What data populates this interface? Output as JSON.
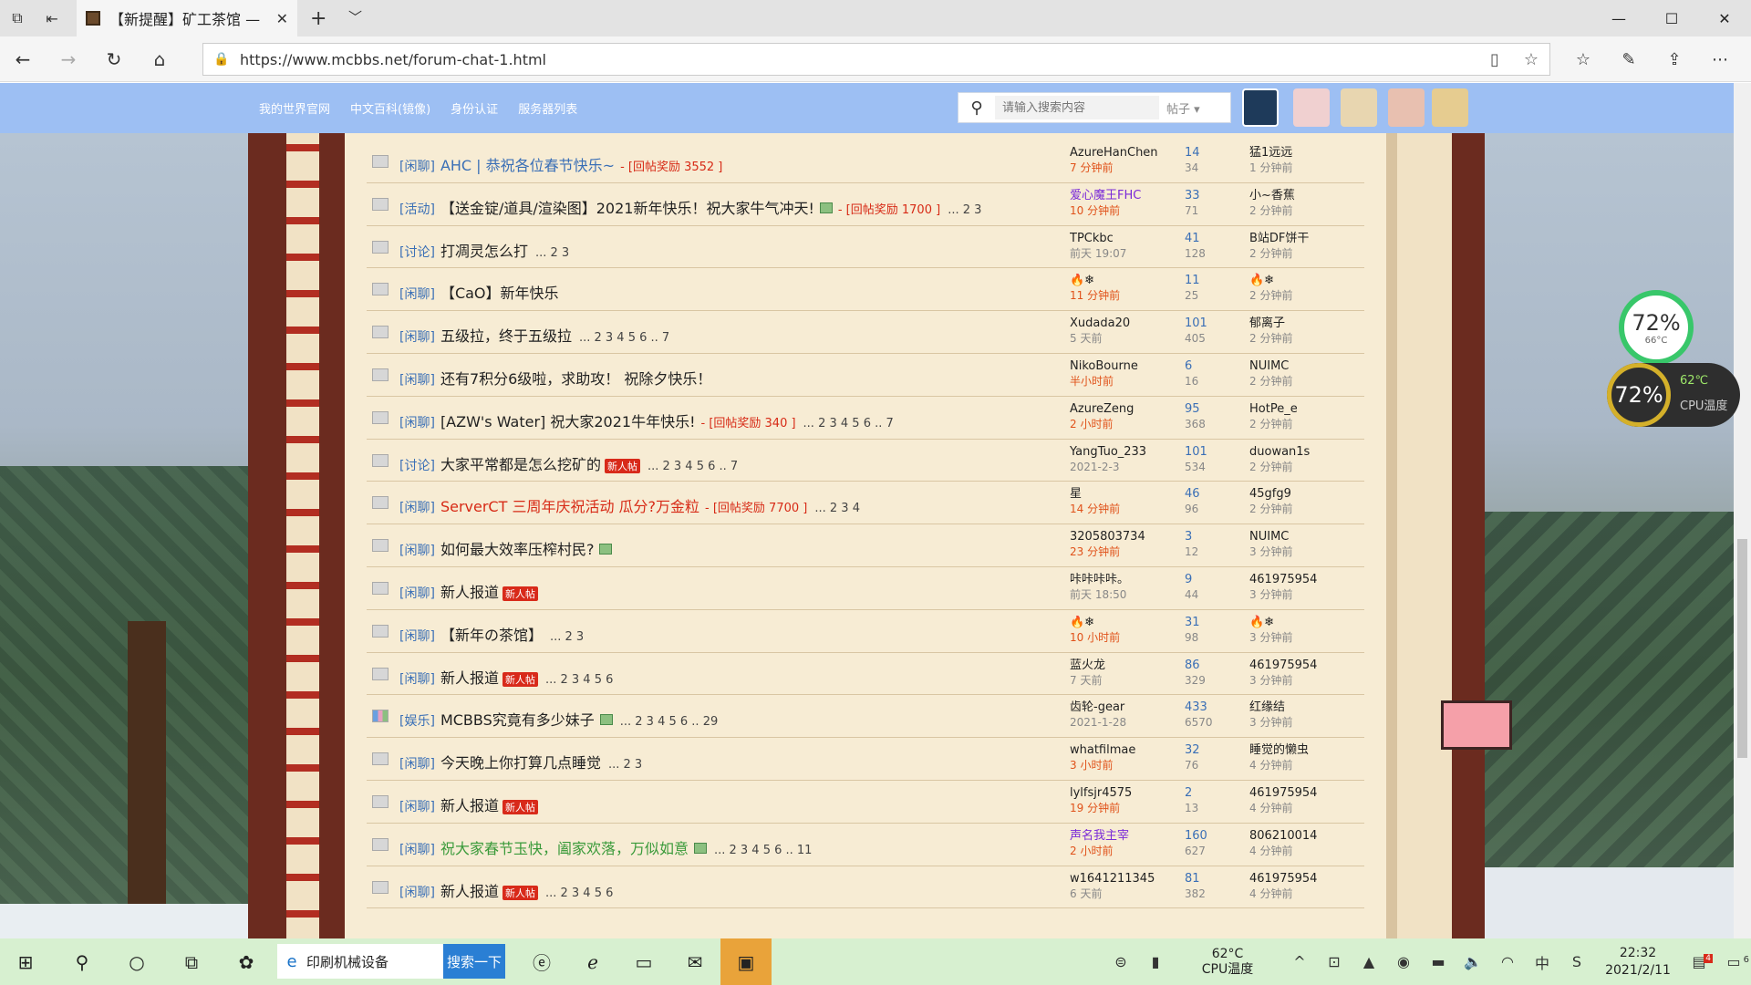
{
  "browser": {
    "tab_title": "【新提醒】矿工茶馆 —",
    "tab_close": "✕",
    "url": "https://www.mcbbs.net/forum-chat-1.html",
    "window_controls": [
      "—",
      "☐",
      "✕"
    ]
  },
  "site": {
    "nav": [
      "我的世界官网",
      "中文百科(镜像)",
      "身份认证",
      "服务器列表"
    ],
    "search_placeholder": "请输入搜索内容",
    "search_scope": "帖子"
  },
  "threads": [
    {
      "cat": "[闲聊]",
      "title": "AHC | 恭祝各位春节快乐~",
      "style": "blue",
      "bonus": "- [回帖奖励 3552 ]",
      "pages": "",
      "badge": "",
      "img": false,
      "author": "AzureHanChen",
      "author_style": "",
      "time": "7 分钟前",
      "time_style": "red",
      "replies": "14",
      "views": "34",
      "last_user": "猛1远远",
      "last_time": "1 分钟前"
    },
    {
      "cat": "[活动]",
      "title": "【送金锭/道具/渲染图】2021新年快乐！祝大家牛气冲天!",
      "style": "",
      "bonus": "- [回帖奖励 1700 ]",
      "pages": "... 2 3",
      "badge": "",
      "img": true,
      "author": "爱心魔王FHC",
      "author_style": "purple",
      "time": "10 分钟前",
      "time_style": "red",
      "replies": "33",
      "views": "71",
      "last_user": "小~香蕉",
      "last_time": "2 分钟前"
    },
    {
      "cat": "[讨论]",
      "title": "打凋灵怎么打",
      "style": "",
      "bonus": "",
      "pages": "... 2 3",
      "badge": "",
      "img": false,
      "author": "TPCkbc",
      "author_style": "",
      "time": "前天 19:07",
      "time_style": "",
      "replies": "41",
      "views": "128",
      "last_user": "B站DF饼干",
      "last_time": "2 分钟前"
    },
    {
      "cat": "[闲聊]",
      "title": "【CaO】新年快乐",
      "style": "",
      "bonus": "",
      "pages": "",
      "badge": "",
      "img": false,
      "author": "🔥❄",
      "author_style": "",
      "time": "11 分钟前",
      "time_style": "red",
      "replies": "11",
      "views": "25",
      "last_user": "🔥❄",
      "last_time": "2 分钟前"
    },
    {
      "cat": "[闲聊]",
      "title": "五级拉，终于五级拉",
      "style": "",
      "bonus": "",
      "pages": "... 2 3 4 5 6 .. 7",
      "badge": "",
      "img": false,
      "author": "Xudada20",
      "author_style": "",
      "time": "5 天前",
      "time_style": "",
      "replies": "101",
      "views": "405",
      "last_user": "郁离子",
      "last_time": "2 分钟前"
    },
    {
      "cat": "[闲聊]",
      "title": "还有7积分6级啦，求助攻！ 祝除夕快乐！",
      "style": "",
      "bonus": "",
      "pages": "",
      "badge": "",
      "img": false,
      "author": "NikoBourne",
      "author_style": "",
      "time": "半小时前",
      "time_style": "red",
      "replies": "6",
      "views": "16",
      "last_user": "NUIMC",
      "last_time": "2 分钟前"
    },
    {
      "cat": "[闲聊]",
      "title": "[AZW's Water] 祝大家2021牛年快乐!",
      "style": "",
      "bonus": "- [回帖奖励 340 ]",
      "pages": "... 2 3 4 5 6 .. 7",
      "badge": "",
      "img": false,
      "author": "AzureZeng",
      "author_style": "",
      "time": "2 小时前",
      "time_style": "red",
      "replies": "95",
      "views": "368",
      "last_user": "HotPe_e",
      "last_time": "2 分钟前"
    },
    {
      "cat": "[讨论]",
      "title": "大家平常都是怎么挖矿的",
      "style": "",
      "bonus": "",
      "pages": "... 2 3 4 5 6 .. 7",
      "badge": "新人帖",
      "img": false,
      "author": "YangTuo_233",
      "author_style": "",
      "time": "2021-2-3",
      "time_style": "",
      "replies": "101",
      "views": "534",
      "last_user": "duowan1s",
      "last_time": "2 分钟前"
    },
    {
      "cat": "[闲聊]",
      "title": "ServerCT 三周年庆祝活动 瓜分?万金粒",
      "style": "red",
      "bonus": "- [回帖奖励 7700 ]",
      "pages": "... 2 3 4",
      "badge": "",
      "img": false,
      "author": "星",
      "author_style": "",
      "time": "14 分钟前",
      "time_style": "red",
      "replies": "46",
      "views": "96",
      "last_user": "45gfg9",
      "last_time": "2 分钟前"
    },
    {
      "cat": "[闲聊]",
      "title": "如何最大效率压榨村民?",
      "style": "",
      "bonus": "",
      "pages": "",
      "badge": "",
      "img": true,
      "author": "3205803734",
      "author_style": "",
      "time": "23 分钟前",
      "time_style": "red",
      "replies": "3",
      "views": "12",
      "last_user": "NUIMC",
      "last_time": "3 分钟前"
    },
    {
      "cat": "[闲聊]",
      "title": "新人报道",
      "style": "",
      "bonus": "",
      "pages": "",
      "badge": "新人帖",
      "img": false,
      "author": "咔咔咔咔。",
      "author_style": "",
      "time": "前天 18:50",
      "time_style": "",
      "replies": "9",
      "views": "44",
      "last_user": "461975954",
      "last_time": "3 分钟前"
    },
    {
      "cat": "[闲聊]",
      "title": "【新年の茶馆】",
      "style": "",
      "bonus": "",
      "pages": "... 2 3",
      "badge": "",
      "img": false,
      "author": "🔥❄",
      "author_style": "",
      "time": "10 小时前",
      "time_style": "red",
      "replies": "31",
      "views": "98",
      "last_user": "🔥❄",
      "last_time": "3 分钟前"
    },
    {
      "cat": "[闲聊]",
      "title": "新人报道",
      "style": "",
      "bonus": "",
      "pages": "... 2 3 4 5 6",
      "badge": "新人帖",
      "img": false,
      "author": "蓝火龙",
      "author_style": "",
      "time": "7 天前",
      "time_style": "",
      "replies": "86",
      "views": "329",
      "last_user": "461975954",
      "last_time": "3 分钟前"
    },
    {
      "cat": "[娱乐]",
      "title": "MCBBS究竟有多少妹子",
      "style": "",
      "bonus": "",
      "pages": "... 2 3 4 5 6 .. 29",
      "badge": "",
      "img": true,
      "hot": true,
      "author": "齿轮-gear",
      "author_style": "",
      "time": "2021-1-28",
      "time_style": "",
      "replies": "433",
      "views": "6570",
      "last_user": "红缘结",
      "last_time": "3 分钟前"
    },
    {
      "cat": "[闲聊]",
      "title": "今天晚上你打算几点睡觉",
      "style": "",
      "bonus": "",
      "pages": "... 2 3",
      "badge": "",
      "img": false,
      "author": "whatfilmae",
      "author_style": "",
      "time": "3 小时前",
      "time_style": "red",
      "replies": "32",
      "views": "76",
      "last_user": "睡觉的懒虫",
      "last_time": "4 分钟前"
    },
    {
      "cat": "[闲聊]",
      "title": "新人报道",
      "style": "",
      "bonus": "",
      "pages": "",
      "badge": "新人帖",
      "img": false,
      "author": "lylfsjr4575",
      "author_style": "",
      "time": "19 分钟前",
      "time_style": "red",
      "replies": "2",
      "views": "13",
      "last_user": "461975954",
      "last_time": "4 分钟前"
    },
    {
      "cat": "[闲聊]",
      "title": "祝大家春节玉快，阖家欢落，万似如意",
      "style": "green",
      "bonus": "",
      "pages": "... 2 3 4 5 6 .. 11",
      "badge": "",
      "img": true,
      "author": "声名我主宰",
      "author_style": "purple",
      "time": "2 小时前",
      "time_style": "red",
      "replies": "160",
      "views": "627",
      "last_user": "806210014",
      "last_time": "4 分钟前"
    },
    {
      "cat": "[闲聊]",
      "title": "新人报道",
      "style": "",
      "bonus": "",
      "pages": "... 2 3 4 5 6",
      "badge": "新人帖",
      "img": false,
      "author": "w1641211345",
      "author_style": "",
      "time": "6 天前",
      "time_style": "",
      "replies": "81",
      "views": "382",
      "last_user": "461975954",
      "last_time": "4 分钟前"
    }
  ],
  "widgets": {
    "mem_percent": "72%",
    "mem_temp": "66°C",
    "cpu_percent": "72%",
    "cpu_temp": "62℃",
    "cpu_label": "CPU温度"
  },
  "taskbar": {
    "search_value": "印刷机械设备",
    "search_button": "搜索一下",
    "temp": "62°C",
    "temp_label": "CPU温度",
    "time": "22:32",
    "date": "2021/2/11",
    "notif_count": "6",
    "mail_count": "4"
  }
}
